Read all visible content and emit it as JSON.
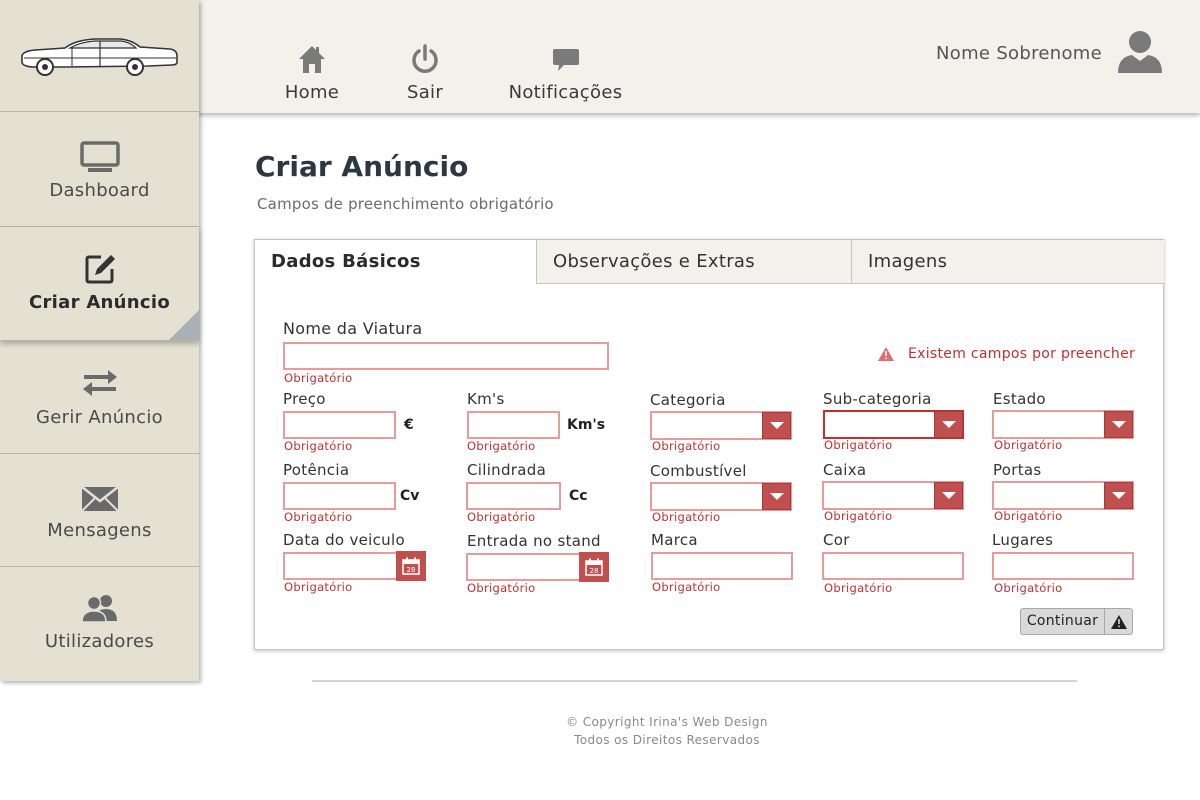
{
  "header": {
    "nav": [
      {
        "label": "Home",
        "icon": "home-icon"
      },
      {
        "label": "Sair",
        "icon": "power-icon"
      },
      {
        "label": "Notificações",
        "icon": "chat-bubble-icon"
      }
    ],
    "user_name": "Nome Sobrenome",
    "avatar_icon": "user-avatar-icon"
  },
  "sidebar": {
    "logo_icon": "classic-car-logo",
    "items": [
      {
        "label": "Dashboard",
        "icon": "monitor-icon"
      },
      {
        "label": "Criar Anúncio",
        "icon": "edit-icon",
        "active": true
      },
      {
        "label": "Gerir Anúncio",
        "icon": "swap-arrows-icon"
      },
      {
        "label": "Mensagens",
        "icon": "envelope-icon"
      },
      {
        "label": "Utilizadores",
        "icon": "users-icon"
      }
    ]
  },
  "page": {
    "title": "Criar Anúncio",
    "subtitle": "Campos de preenchimento obrigatório"
  },
  "tabs": [
    "Dados Básicos",
    "Observações e Extras",
    "Imagens"
  ],
  "form": {
    "required_text": "Obrigatório",
    "warning": "Existem campos por preencher",
    "fields": {
      "nome_viatura": {
        "label": "Nome da Viatura",
        "value": ""
      },
      "preco": {
        "label": "Preço",
        "unit": "€",
        "value": ""
      },
      "kms": {
        "label": "Km's",
        "unit": "Km's",
        "value": ""
      },
      "categoria": {
        "label": "Categoria",
        "value": ""
      },
      "subcategoria": {
        "label": "Sub-categoria",
        "value": ""
      },
      "estado": {
        "label": "Estado",
        "value": ""
      },
      "potencia": {
        "label": "Potência",
        "unit": "Cv",
        "value": ""
      },
      "cilindrada": {
        "label": "Cilindrada",
        "unit": "Cc",
        "value": ""
      },
      "combustivel": {
        "label": "Combustível",
        "value": ""
      },
      "caixa": {
        "label": "Caixa",
        "value": ""
      },
      "portas": {
        "label": "Portas",
        "value": ""
      },
      "data_veiculo": {
        "label": "Data do veiculo",
        "value": ""
      },
      "entrada_stand": {
        "label": "Entrada no stand",
        "value": ""
      },
      "marca": {
        "label": "Marca",
        "value": ""
      },
      "cor": {
        "label": "Cor",
        "value": ""
      },
      "lugares": {
        "label": "Lugares",
        "value": ""
      }
    },
    "calendar_day": "28",
    "continue_label": "Continuar"
  },
  "footer": {
    "line1": "© Copyright Irina's Web Design",
    "line2": "Todos os Direitos Reservados"
  },
  "colors": {
    "accent": "#c0504f",
    "error": "#c0302f",
    "sidebar_bg": "#e4e1d3",
    "topbar_bg": "#f3f1ec"
  }
}
